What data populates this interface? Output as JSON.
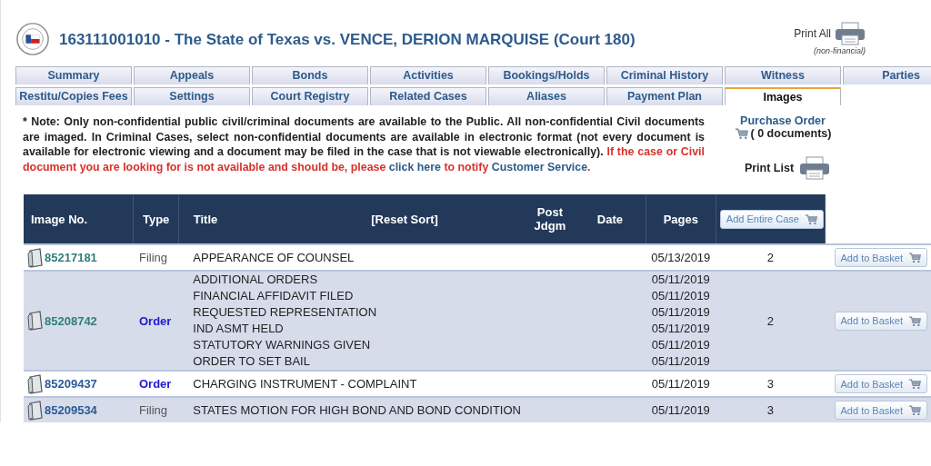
{
  "header": {
    "title": "163111001010 - The State of Texas vs. VENCE, DERION MARQUISE (Court 180)",
    "print_all": "Print All",
    "print_note": "(non-financial)"
  },
  "tab_rows": [
    [
      {
        "label": "Summary",
        "selected": false
      },
      {
        "label": "Appeals",
        "selected": false
      },
      {
        "label": "Bonds",
        "selected": false
      },
      {
        "label": "Activities",
        "selected": false
      },
      {
        "label": "Bookings/Holds",
        "selected": false
      },
      {
        "label": "Criminal History",
        "selected": false
      },
      {
        "label": "Witness",
        "selected": false
      },
      {
        "label": "Parties",
        "selected": false
      }
    ],
    [
      {
        "label": "Restitu/Copies Fees",
        "selected": false
      },
      {
        "label": "Settings",
        "selected": false
      },
      {
        "label": "Court Registry",
        "selected": false
      },
      {
        "label": "Related Cases",
        "selected": false
      },
      {
        "label": "Aliases",
        "selected": false
      },
      {
        "label": "Payment Plan",
        "selected": false
      },
      {
        "label": "Images",
        "selected": true
      }
    ]
  ],
  "note": [
    {
      "kind": "note",
      "text": "* Note: Only non-confidential public civil/criminal documents are available to the Public. All non-confidential Civil documents are imaged. In Criminal Cases, select non-confidential documents are available in electronic format (not every document is available for electronic viewing and a document may be filed in the case that is not viewable electronically). "
    },
    {
      "kind": "alert",
      "text": "If the case or Civil document you are looking for is not available and should be, please "
    },
    {
      "kind": "link",
      "text": "click here"
    },
    {
      "kind": "alert",
      "text": " to notify "
    },
    {
      "kind": "link",
      "text": "Customer Service"
    },
    {
      "kind": "alert",
      "text": "."
    }
  ],
  "purchase_order": {
    "link": "Purchase Order",
    "count": "( 0 documents)"
  },
  "print_list": "Print List",
  "table": {
    "columns": [
      "Image No.",
      "Type",
      "Title",
      "[Reset Sort]",
      "Post Jdgm",
      "Date",
      "Pages"
    ],
    "header_button": "Add Entire Case",
    "rows": [
      {
        "image_no": "85217181",
        "visited": true,
        "type": "Filing",
        "kind": "filing",
        "entries": [
          {
            "title": "APPEARANCE OF COUNSEL",
            "date": "05/13/2019"
          }
        ],
        "pages": "2",
        "button": "Add to Basket"
      },
      {
        "image_no": "85208742",
        "visited": true,
        "type": "Order",
        "kind": "order",
        "entries": [
          {
            "title": "ADDITIONAL ORDERS",
            "date": "05/11/2019"
          },
          {
            "title": "FINANCIAL AFFIDAVIT FILED",
            "date": "05/11/2019"
          },
          {
            "title": "REQUESTED REPRESENTATION",
            "date": "05/11/2019"
          },
          {
            "title": "IND ASMT HELD",
            "date": "05/11/2019"
          },
          {
            "title": "STATUTORY WARNINGS GIVEN",
            "date": "05/11/2019"
          },
          {
            "title": "ORDER TO SET BAIL",
            "date": "05/11/2019"
          }
        ],
        "pages": "2",
        "button": "Add to Basket"
      },
      {
        "image_no": "85209437",
        "visited": false,
        "type": "Order",
        "kind": "order",
        "entries": [
          {
            "title": "CHARGING INSTRUMENT - COMPLAINT",
            "date": "05/11/2019"
          }
        ],
        "pages": "3",
        "button": "Add to Basket"
      },
      {
        "image_no": "85209534",
        "visited": false,
        "type": "Filing",
        "kind": "filing",
        "entries": [
          {
            "title": "STATES MOTION FOR HIGH BOND AND BOND CONDITION",
            "date": "05/11/2019"
          }
        ],
        "pages": "3",
        "button": "Add to Basket"
      }
    ]
  }
}
